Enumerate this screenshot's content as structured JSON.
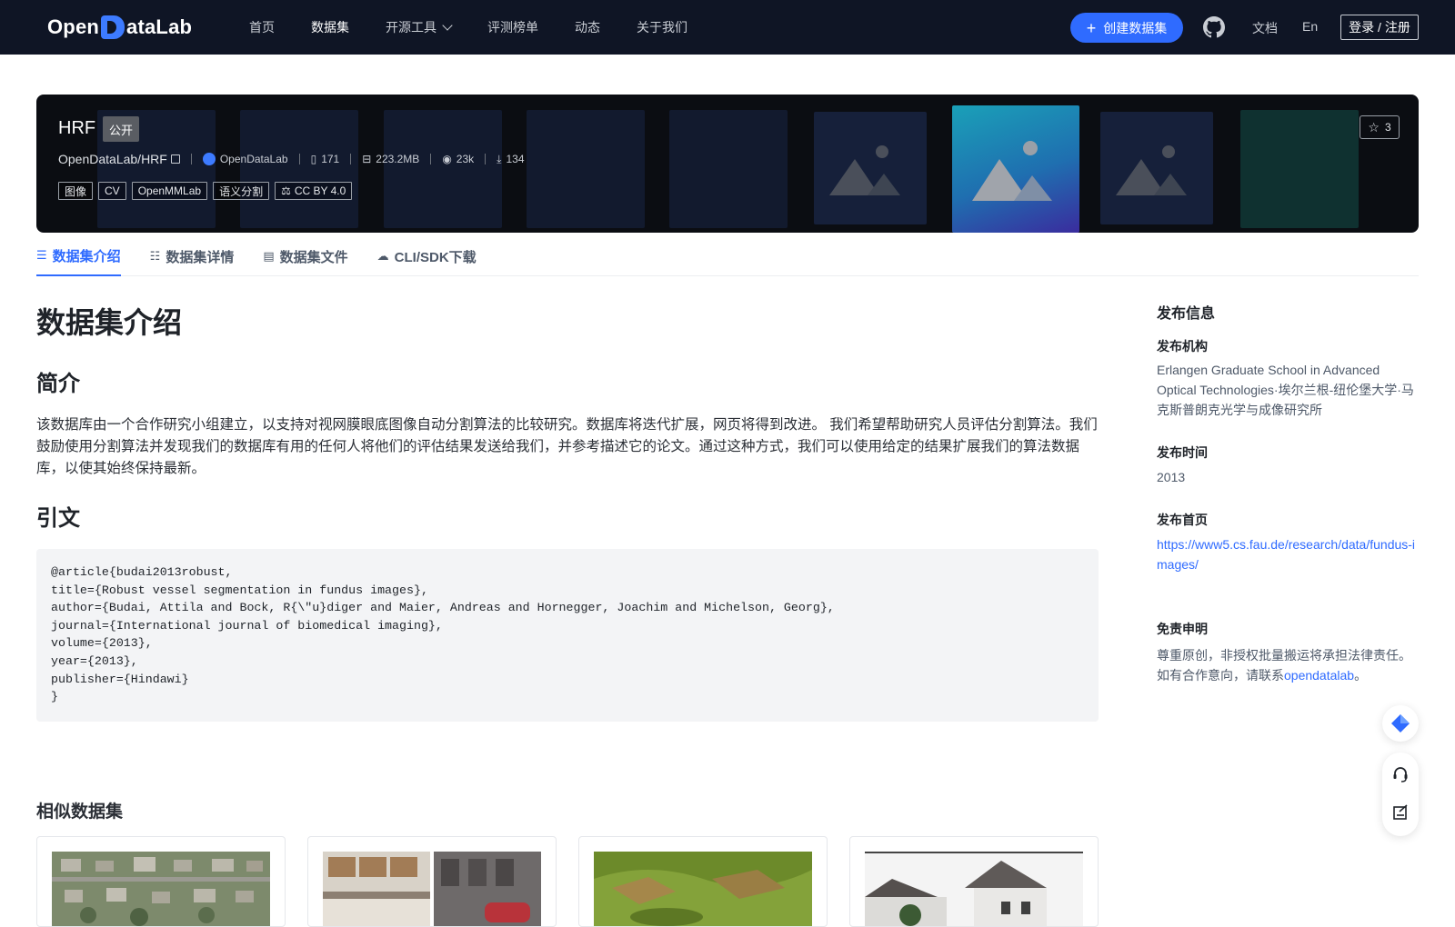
{
  "nav": {
    "logo_left": "Open",
    "logo_right": "ataLab",
    "links": [
      {
        "label": "首页"
      },
      {
        "label": "数据集",
        "active": true
      },
      {
        "label": "开源工具",
        "dropdown": true
      },
      {
        "label": "评测榜单"
      },
      {
        "label": "动态"
      },
      {
        "label": "关于我们"
      }
    ],
    "create_label": "创建数据集",
    "docs_label": "文档",
    "lang_label": "En",
    "login_label": "登录 / 注册",
    "icons": {
      "github": "github-icon",
      "plus": "plus-icon",
      "dropdown": "chevron-down-icon"
    }
  },
  "dataset": {
    "name": "HRF",
    "visibility": "公开",
    "path": "OpenDataLab/HRF",
    "org": "OpenDataLab",
    "files": "171",
    "size": "223.2MB",
    "views": "23k",
    "downloads": "134",
    "tags": [
      "图像",
      "CV",
      "OpenMMLab",
      "语义分割"
    ],
    "license": "CC BY 4.0",
    "stars": "3",
    "colors": {
      "banner_bg": "#0b0d12",
      "highlight_from": "#1aa0b8",
      "highlight_to": "#3a2c9e"
    }
  },
  "tabs": [
    {
      "label": "数据集介绍",
      "icon": "database-icon",
      "active": true
    },
    {
      "label": "数据集详情",
      "icon": "list-icon"
    },
    {
      "label": "数据集文件",
      "icon": "file-icon"
    },
    {
      "label": "CLI/SDK下载",
      "icon": "cloud-download-icon"
    }
  ],
  "content": {
    "title": "数据集介绍",
    "intro_heading": "简介",
    "intro_text": "该数据库由一个合作研究小组建立，以支持对视网膜眼底图像自动分割算法的比较研究。数据库将迭代扩展，网页将得到改进。 我们希望帮助研究人员评估分割算法。我们鼓励使用分割算法并发现我们的数据库有用的任何人将他们的评估结果发送给我们，并参考描述它的论文。通过这种方式，我们可以使用给定的结果扩展我们的算法数据库，以使其始终保持最新。",
    "citation_heading": "引文",
    "citation": "@article{budai2013robust,\ntitle={Robust vessel segmentation in fundus images},\nauthor={Budai, Attila and Bock, R{\\\"u}diger and Maier, Andreas and Hornegger, Joachim and Michelson, Georg},\njournal={International journal of biomedical imaging},\nvolume={2013},\nyear={2013},\npublisher={Hindawi}\n}",
    "similar_heading": "相似数据集"
  },
  "sidebar": {
    "title": "发布信息",
    "org_label": "发布机构",
    "org_value": "Erlangen Graduate School in Advanced Optical Technologies·埃尔兰根-纽伦堡大学·马克斯普朗克光学与成像研究所",
    "time_label": "发布时间",
    "time_value": "2013",
    "home_label": "发布首页",
    "home_value": "https://www5.cs.fau.de/research/data/fundus-images/",
    "disclaimer_label": "免责申明",
    "disclaimer_line1": "尊重原创，非授权批量搬运将承担法律责任。",
    "disclaimer_prefix": "如有合作意向，请联系",
    "disclaimer_link": "opendatalab",
    "disclaimer_suffix": "。"
  }
}
